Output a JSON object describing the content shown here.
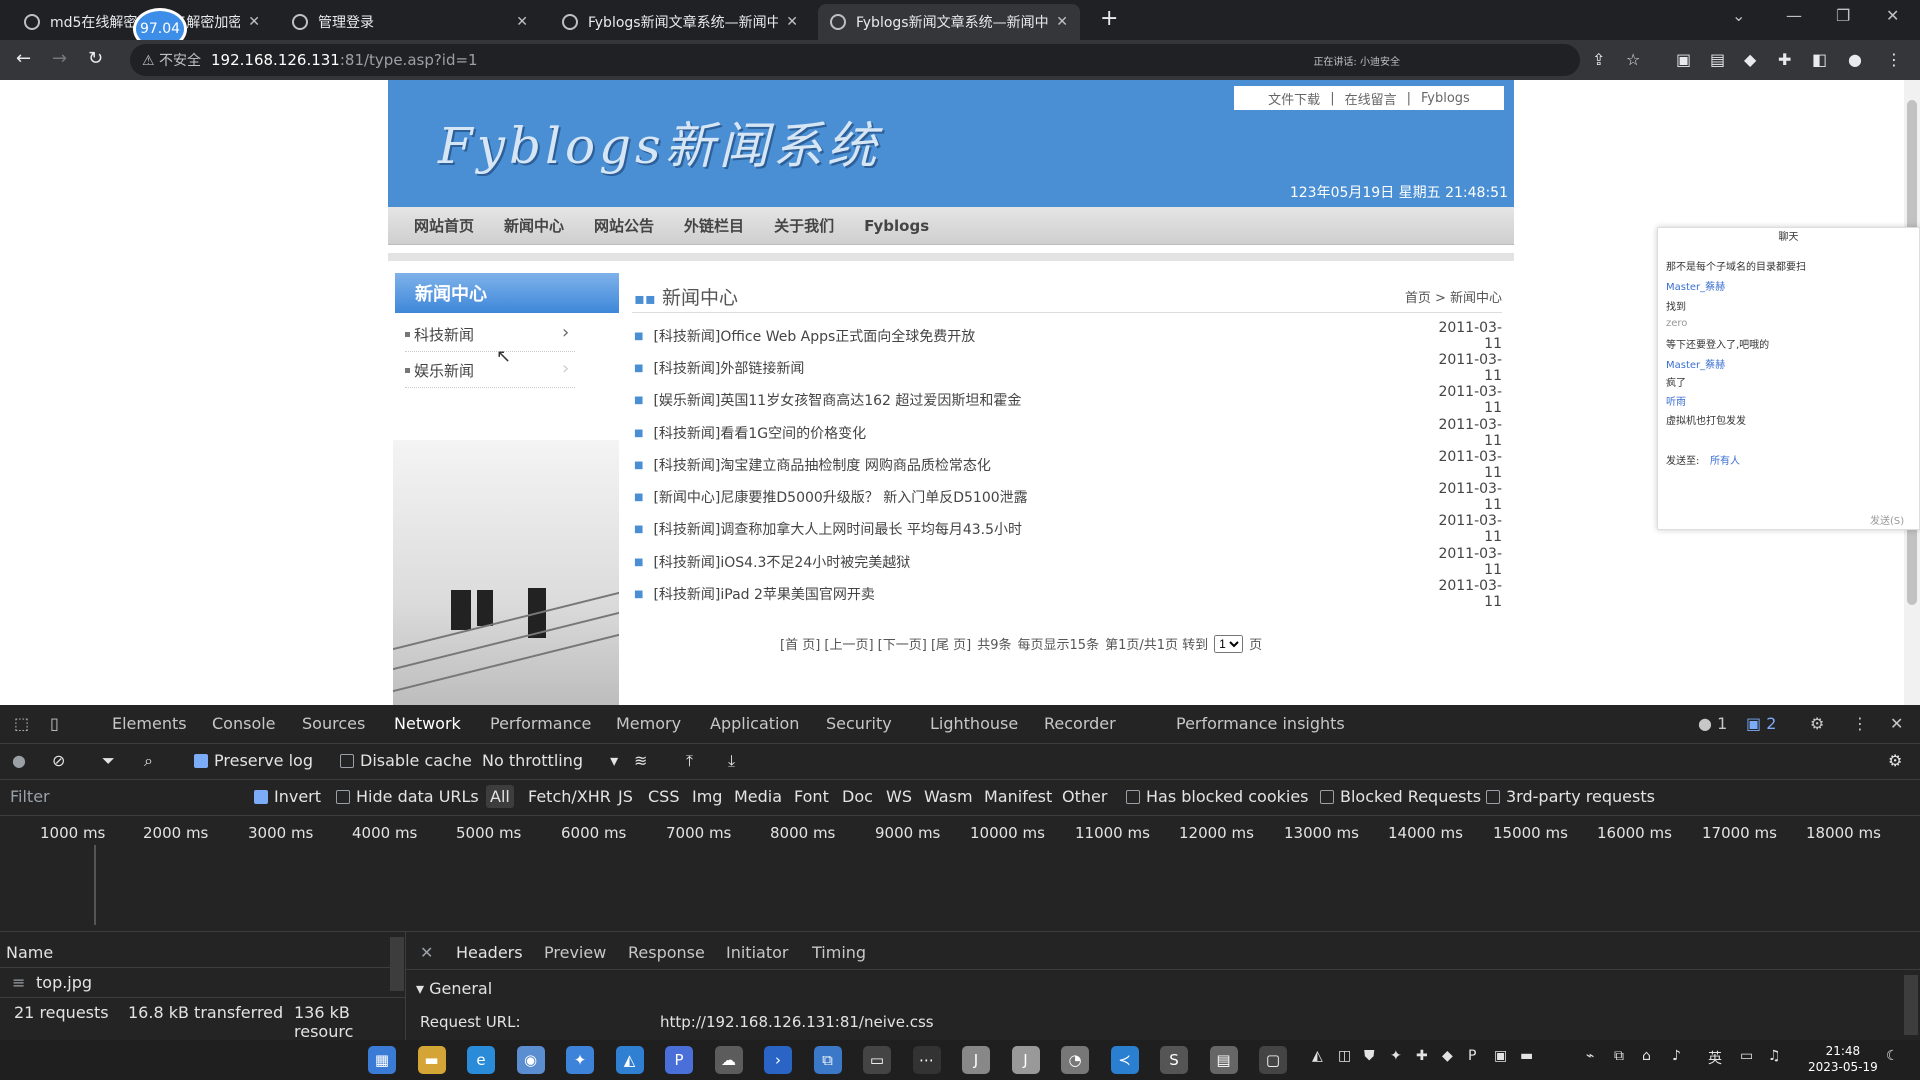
{
  "browser": {
    "tabs": [
      {
        "title": "md5在线解密",
        "active": false
      },
      {
        "title": "管理登录",
        "active": false
      },
      {
        "title": "Fyblogs新闻文章系统—新闻中心",
        "active": false
      },
      {
        "title": "Fyblogs新闻文章系统—新闻中心",
        "active": true
      }
    ],
    "tab1_suffix": "5解密加密",
    "badge": "97.04",
    "new_tab": "+",
    "url_warning": "不安全",
    "url_host": "192.168.126.131",
    "url_rest": ":81/type.asp?id=1",
    "status_snippet": "正在讲话: 小迪安全"
  },
  "site": {
    "logo": "Fyblogs新闻系统",
    "top_links": [
      "文件下载",
      "在线留言",
      "Fyblogs"
    ],
    "top_link_sep": "|",
    "datetime": "123年05月19日 星期五 21:48:51",
    "menu": [
      "网站首页",
      "新闻中心",
      "网站公告",
      "外链栏目",
      "关于我们",
      "Fyblogs"
    ],
    "sidebar": {
      "title": "新闻中心",
      "items": [
        "科技新闻",
        "娱乐新闻"
      ]
    },
    "main": {
      "title": "新闻中心",
      "breadcrumb": "首页 > 新闻中心",
      "news": [
        {
          "title": "[科技新闻]Office Web Apps正式面向全球免费开放",
          "date": "2011-03-11"
        },
        {
          "title": "[科技新闻]外部链接新闻",
          "date": "2011-03-11"
        },
        {
          "title": "[娱乐新闻]英国11岁女孩智商高达162 超过爱因斯坦和霍金",
          "date": "2011-03-11"
        },
        {
          "title": "[科技新闻]看看1G空间的价格变化",
          "date": "2011-03-11"
        },
        {
          "title": "[科技新闻]淘宝建立商品抽检制度 网购商品质检常态化",
          "date": "2011-03-11"
        },
        {
          "title": "[新闻中心]尼康要推D5000升级版？ 新入门单反D5100泄露",
          "date": "2011-03-11"
        },
        {
          "title": "[科技新闻]调查称加拿大人上网时间最长 平均每月43.5小时",
          "date": "2011-03-11"
        },
        {
          "title": "[科技新闻]iOS4.3不足24小时被完美越狱",
          "date": "2011-03-11"
        },
        {
          "title": "[科技新闻]iPad 2苹果美国官网开卖",
          "date": "2011-03-11"
        }
      ],
      "pager": {
        "links": "[首 页] [上一页] [下一页] [尾 页]",
        "total": "共9条",
        "per_page": "每页显示15条",
        "page": "第1页/共1页 转到",
        "select": "1",
        "suffix": "页"
      }
    }
  },
  "chat": {
    "title": "聊天",
    "lines": [
      {
        "text": "那不是每个子域名的目录都要扫",
        "color": "#333333"
      },
      {
        "text": "Master_蔡赫",
        "color": "#3a6fd0"
      },
      {
        "text": "找到",
        "color": "#333333"
      },
      {
        "text": "zero",
        "color": "#999999"
      },
      {
        "text": "等下还要登入了,吧哦的",
        "color": "#333333"
      },
      {
        "text": "Master_蔡赫",
        "color": "#3a6fd0"
      },
      {
        "text": "疯了",
        "color": "#333333"
      },
      {
        "text": "听雨",
        "color": "#3a6fd0"
      },
      {
        "text": "虚拟机也打包发发",
        "color": "#333333"
      }
    ],
    "send_to": "发送至:",
    "recipient": "所有人",
    "send": "发送(S)"
  },
  "devtools": {
    "tabs": [
      "Elements",
      "Console",
      "Sources",
      "Network",
      "Performance",
      "Memory",
      "Application",
      "Security",
      "Lighthouse",
      "Recorder",
      "Performance insights"
    ],
    "active_tab": "Network",
    "error_count": "1",
    "message_count": "2",
    "toolbar": {
      "preserve_log": "Preserve log",
      "disable_cache": "Disable cache",
      "throttling": "No throttling"
    },
    "filter": {
      "placeholder": "Filter",
      "invert": "Invert",
      "hide_data_urls": "Hide data URLs",
      "types": [
        "All",
        "Fetch/XHR",
        "JS",
        "CSS",
        "Img",
        "Media",
        "Font",
        "Doc",
        "WS",
        "Wasm",
        "Manifest",
        "Other"
      ],
      "has_blocked_cookies": "Has blocked cookies",
      "blocked_requests": "Blocked Requests",
      "third_party": "3rd-party requests"
    },
    "timeline_ticks": [
      "1000 ms",
      "2000 ms",
      "3000 ms",
      "4000 ms",
      "5000 ms",
      "6000 ms",
      "7000 ms",
      "8000 ms",
      "9000 ms",
      "10000 ms",
      "11000 ms",
      "12000 ms",
      "13000 ms",
      "14000 ms",
      "15000 ms",
      "16000 ms",
      "17000 ms",
      "18000 ms"
    ],
    "name_header": "Name",
    "request_item": "top.jpg",
    "detail_tabs": [
      "Headers",
      "Preview",
      "Response",
      "Initiator",
      "Timing"
    ],
    "general": "General",
    "request_url_label": "Request URL:",
    "request_url": "http://192.168.126.131:81/neive.css",
    "summary": {
      "requests": "21 requests",
      "transferred": "16.8 kB transferred",
      "resources": "136 kB resourc"
    }
  },
  "taskbar": {
    "apps": [
      {
        "name": "windows",
        "glyph": "▦",
        "color": "#3a7bd5"
      },
      {
        "name": "files",
        "glyph": "▬",
        "color": "#d4a437"
      },
      {
        "name": "edge",
        "glyph": "e",
        "color": "#2a8bd8"
      },
      {
        "name": "chrome",
        "glyph": "◉",
        "color": "#5a8ed0"
      },
      {
        "name": "app5",
        "glyph": "✦",
        "color": "#3d83d9"
      },
      {
        "name": "app6",
        "glyph": "◭",
        "color": "#2f7fd3"
      },
      {
        "name": "app7",
        "glyph": "P",
        "color": "#4b6fd8"
      },
      {
        "name": "app8",
        "glyph": "☁",
        "color": "#5c5c5c"
      },
      {
        "name": "powershell",
        "glyph": "›",
        "color": "#2a64c5"
      },
      {
        "name": "app10",
        "glyph": "⧉",
        "color": "#3c78c8"
      },
      {
        "name": "terminal",
        "glyph": "▭",
        "color": "#444444"
      },
      {
        "name": "app12",
        "glyph": "⋯",
        "color": "#333333"
      },
      {
        "name": "app13",
        "glyph": "J",
        "color": "#888888"
      },
      {
        "name": "app14",
        "glyph": "J",
        "color": "#999999"
      },
      {
        "name": "app15",
        "glyph": "◔",
        "color": "#777777"
      },
      {
        "name": "vscode",
        "glyph": "≺",
        "color": "#2b7fd0"
      },
      {
        "name": "app17",
        "glyph": "S",
        "color": "#555555"
      },
      {
        "name": "app18",
        "glyph": "▤",
        "color": "#666666"
      },
      {
        "name": "app19",
        "glyph": "▢",
        "color": "#444444"
      }
    ],
    "ime": "英",
    "time": "21:48",
    "date": "2023-05-19"
  }
}
